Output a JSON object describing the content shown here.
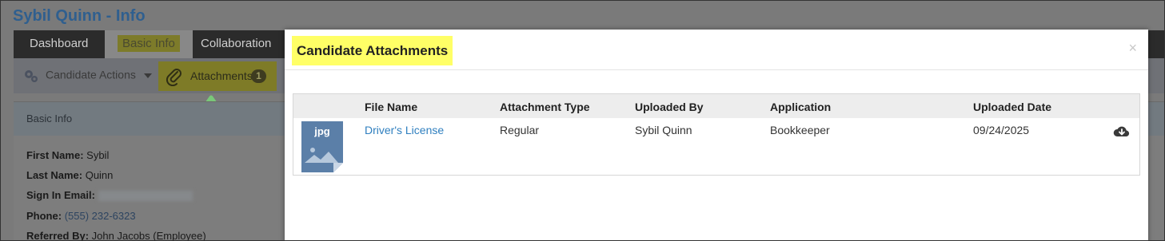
{
  "page": {
    "title": "Sybil Quinn - Info"
  },
  "nav": {
    "tabs": [
      {
        "label": "Dashboard"
      },
      {
        "label": "Basic Info"
      },
      {
        "label": "Collaboration"
      }
    ]
  },
  "toolbar": {
    "candidate_actions_label": "Candidate Actions",
    "attachments_label": "Attachments",
    "attachments_count": "1"
  },
  "basic_info": {
    "panel_title": "Basic Info",
    "first_name_label": "First Name:",
    "first_name": "Sybil",
    "last_name_label": "Last Name:",
    "last_name": "Quinn",
    "sign_in_email_label": "Sign In Email:",
    "phone_label": "Phone:",
    "phone": "(555) 232-6323",
    "referred_by_label": "Referred By:",
    "referred_by": "John Jacobs (Employee)"
  },
  "modal": {
    "title": "Candidate Attachments",
    "close_glyph": "×",
    "columns": {
      "file_name": "File Name",
      "attachment_type": "Attachment Type",
      "uploaded_by": "Uploaded By",
      "application": "Application",
      "uploaded_date": "Uploaded Date"
    },
    "rows": [
      {
        "file_type": "jpg",
        "file_name": "Driver's License",
        "attachment_type": "Regular",
        "uploaded_by": "Sybil Quinn",
        "application": "Bookkeeper",
        "uploaded_date": "09/24/2025"
      }
    ]
  },
  "colors": {
    "highlight": "#ffff66",
    "link": "#2f7fbf",
    "file_icon": "#5b7fa8",
    "green_arrow": "#79c879"
  },
  "icons": {
    "gear": "gear-icon",
    "paperclip": "paperclip-icon",
    "download": "cloud-download-icon",
    "file": "image-file-icon"
  }
}
